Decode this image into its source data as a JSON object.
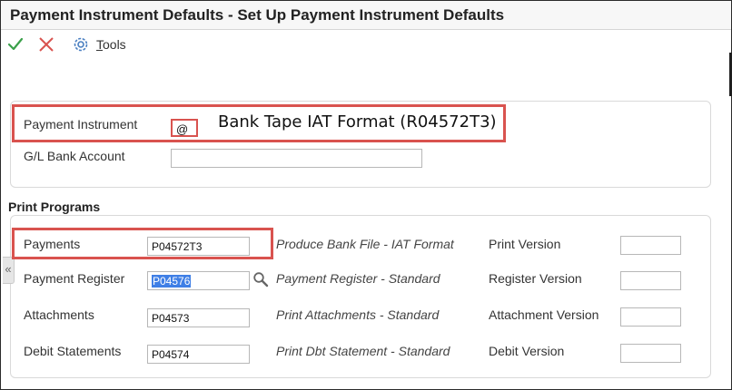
{
  "header": {
    "title": "Payment Instrument Defaults - Set Up Payment Instrument Defaults"
  },
  "toolbar": {
    "ok_icon": "checkmark-icon",
    "cancel_icon": "close-icon",
    "tools_icon": "gear-icon",
    "tools_label": "Tools"
  },
  "header_form": {
    "payment_instrument_label": "Payment Instrument",
    "payment_instrument_value": "@",
    "payment_instrument_description": "Bank Tape IAT Format (R04572T3)",
    "gl_bank_account_label": "G/L Bank Account",
    "gl_bank_account_value": ""
  },
  "print_programs": {
    "section_title": "Print Programs",
    "rows": [
      {
        "label": "Payments",
        "program": "P04572T3",
        "description": "Produce Bank File - IAT Format",
        "version_label": "Print Version",
        "version_value": ""
      },
      {
        "label": "Payment Register",
        "program": "P04576",
        "description": "Payment Register - Standard",
        "version_label": "Register Version",
        "version_value": ""
      },
      {
        "label": "Attachments",
        "program": "P04573",
        "description": "Print Attachments - Standard",
        "version_label": "Attachment Version",
        "version_value": ""
      },
      {
        "label": "Debit Statements",
        "program": "P04574",
        "description": "Print Dbt Statement - Standard",
        "version_label": "Debit Version",
        "version_value": ""
      }
    ]
  },
  "sidebar_toggle": {
    "glyph": "«"
  },
  "colors": {
    "accent_green": "#3aa04a",
    "cancel_red": "#d9534f",
    "highlight_red": "#d9534f",
    "selection_blue": "#3f7fe6",
    "tools_blue": "#4a7fc1"
  }
}
